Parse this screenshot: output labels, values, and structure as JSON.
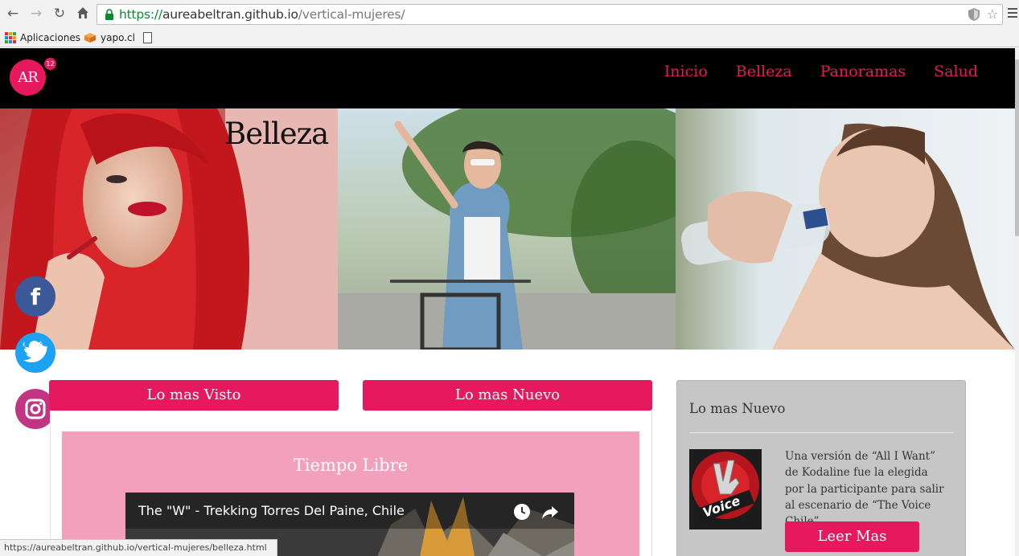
{
  "browser": {
    "url_scheme": "https://",
    "url_host": "aureabeltran.github.io",
    "url_path": "/vertical-mujeres/",
    "bookmarks": [
      {
        "label": "Aplicaciones",
        "icon": "apps-grid-icon"
      },
      {
        "label": "yapo.cl",
        "icon": "yapo-box-icon"
      },
      {
        "label": "",
        "icon": "page-icon"
      }
    ],
    "status_url": "https://aureabeltran.github.io/vertical-mujeres/belleza.html"
  },
  "header": {
    "logo_text": "AR",
    "logo_badge": "12",
    "nav": [
      "Inicio",
      "Belleza",
      "Panoramas",
      "Salud"
    ]
  },
  "hero": {
    "title": "Belleza"
  },
  "social": {
    "facebook_glyph": "f"
  },
  "tabs": {
    "most_viewed": "Lo mas Visto",
    "newest": "Lo mas Nuevo"
  },
  "featured": {
    "title": "Tiempo Libre",
    "video_title": "The \"W\" - Trekking Torres Del Paine, Chile"
  },
  "sidebar": {
    "title": "Lo mas Nuevo",
    "text": "Una versión de “All I Want” de Kodaline fue la elegida por la participante para salir al escenario de “The Voice Chile”.",
    "button": "Leer Mas",
    "thumb_text": "Voice"
  },
  "colors": {
    "accent": "#e6195f",
    "header_bg": "#000000",
    "pink_panel": "#f3a0bc",
    "sidebar_bg": "#c6c6c6",
    "facebook": "#3b5998",
    "twitter": "#1da1f2",
    "instagram": "#c13584"
  }
}
